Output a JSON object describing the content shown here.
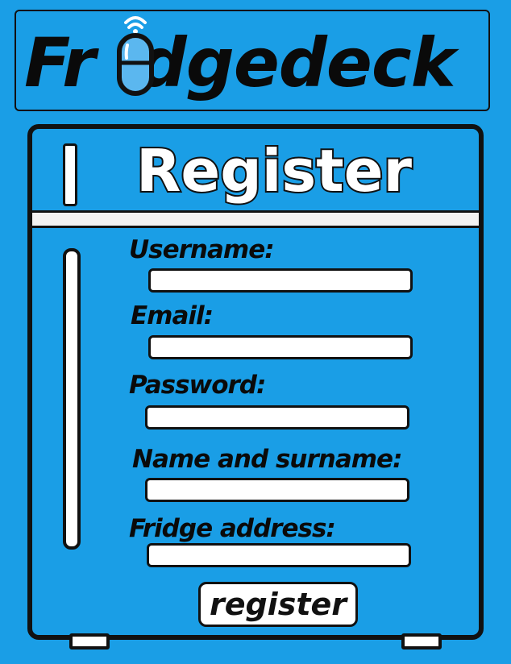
{
  "app": {
    "logo_left": "Fr",
    "logo_right": "dgedeck"
  },
  "form": {
    "title": "Register",
    "fields": [
      {
        "label": "Username:",
        "value": ""
      },
      {
        "label": "Email:",
        "value": ""
      },
      {
        "label": "Password:",
        "value": ""
      },
      {
        "label": "Name and surname:",
        "value": ""
      },
      {
        "label": "Fridge address:",
        "value": ""
      }
    ],
    "submit_label": "register"
  },
  "colors": {
    "background": "#1a9ee6",
    "outline": "#111111",
    "field": "#ffffff"
  },
  "icons": {
    "logo_i": "wireless-sensor-icon",
    "door_handles": "handle"
  }
}
